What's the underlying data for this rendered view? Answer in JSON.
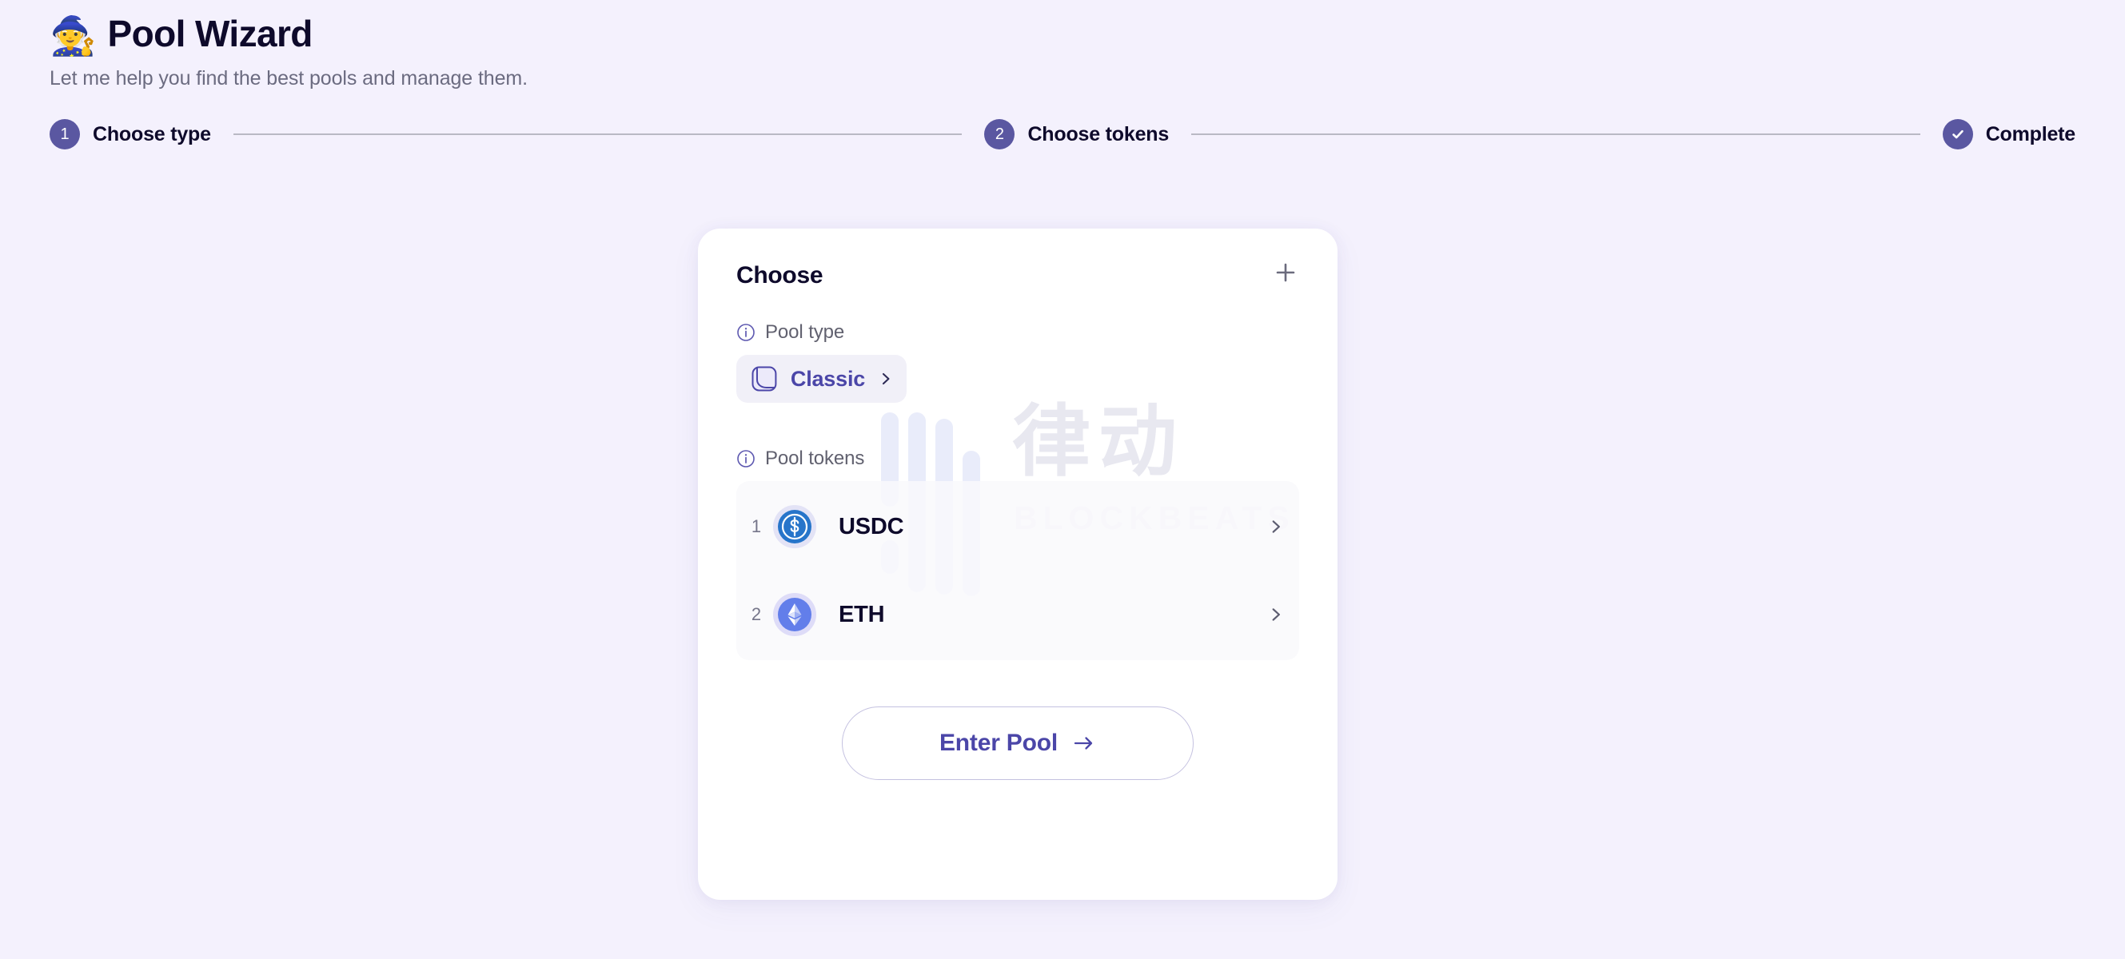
{
  "header": {
    "emoji": "🧙",
    "emoji_name": "wizard-emoji",
    "title": "Pool Wizard",
    "subtitle": "Let me help you find the best pools and manage them."
  },
  "stepper": {
    "steps": [
      {
        "badge": "1",
        "label": "Choose type",
        "state": "active"
      },
      {
        "badge": "2",
        "label": "Choose tokens",
        "state": "active"
      },
      {
        "badge": "✔",
        "label": "Complete",
        "state": "complete"
      }
    ]
  },
  "card": {
    "title": "Choose",
    "add_icon": "plus-icon",
    "pool_type_section": {
      "label": "Pool type",
      "info_icon": "info-circle-icon",
      "selected": {
        "name": "Classic",
        "icon": "classic-pool-icon",
        "chevron": "chevron-right-icon"
      }
    },
    "pool_tokens_section": {
      "label": "Pool tokens",
      "info_icon": "info-circle-icon",
      "tokens": [
        {
          "index": "1",
          "symbol": "USDC",
          "icon": "usdc-token-icon",
          "chevron": "chevron-right-icon"
        },
        {
          "index": "2",
          "symbol": "ETH",
          "icon": "eth-token-icon",
          "chevron": "chevron-right-icon"
        }
      ]
    },
    "submit": {
      "label": "Enter Pool",
      "icon": "arrow-right-icon"
    }
  },
  "watermark": {
    "cjk": "律动",
    "latin": "BLOCKBEATS",
    "logo_icon": "blockbeats-bars-logo"
  },
  "colors": {
    "page_background": "#f4f1fd",
    "card_background": "#ffffff",
    "accent_indigo": "#4b46a8",
    "step_badge": "#5a57a1",
    "text_primary": "#0e0a2b",
    "text_muted": "#6b6b80",
    "usdc_blue": "#2775ca",
    "eth_purple": "#627eea",
    "connector_gray": "#b9b9c4"
  }
}
